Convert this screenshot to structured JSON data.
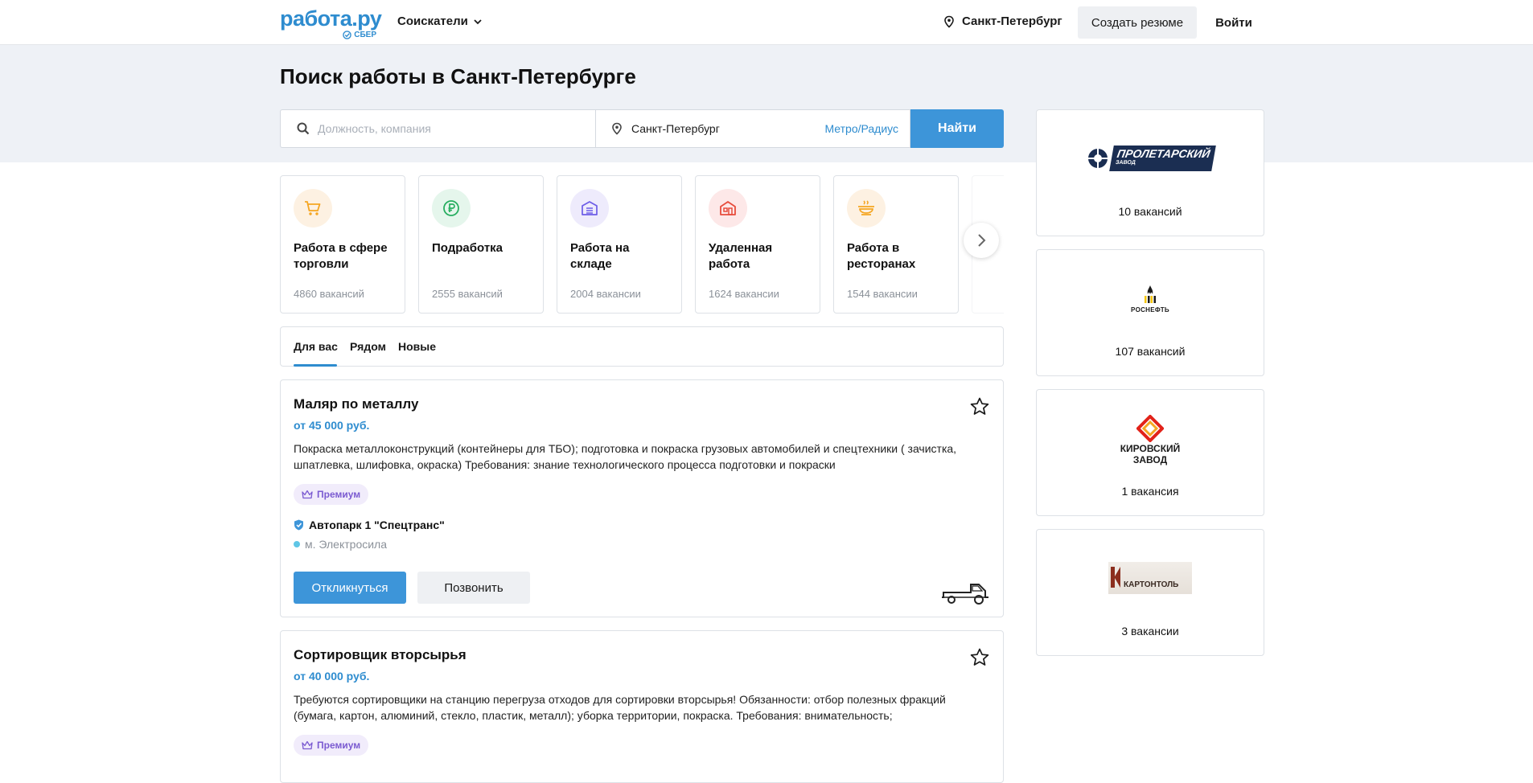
{
  "header": {
    "logo_text": "работа.ру",
    "logo_sub": "СБЕР",
    "seekers_label": "Соискатели",
    "city": "Санкт-Петербург",
    "create_resume": "Создать резюме",
    "login": "Войти"
  },
  "page_title": "Поиск работы в Санкт-Петербурге",
  "search": {
    "query_placeholder": "Должность, компания",
    "city_value": "Санкт-Петербург",
    "metro_link": "Метро/Радиус",
    "submit": "Найти"
  },
  "categories": [
    {
      "name": "Работа в сфере торговли",
      "count": "4860 вакансий",
      "icon": "cart-icon",
      "color": "#f5a623",
      "bg": "#fdf1e2"
    },
    {
      "name": "Подработка",
      "count": "2555 вакансий",
      "icon": "ruble-icon",
      "color": "#27ae60",
      "bg": "#e5f6ec"
    },
    {
      "name": "Работа на складе",
      "count": "2004 вакансии",
      "icon": "warehouse-icon",
      "color": "#6c5ce7",
      "bg": "#eeebfc"
    },
    {
      "name": "Удаленная работа",
      "count": "1624 вакансии",
      "icon": "house-icon",
      "color": "#e74c3c",
      "bg": "#fde8e8"
    },
    {
      "name": "Работа в ресторанах",
      "count": "1544 вакансии",
      "icon": "dish-icon",
      "color": "#f5a623",
      "bg": "#fdf1e2"
    }
  ],
  "tabs": [
    "Для вас",
    "Рядом",
    "Новые"
  ],
  "vacancies": [
    {
      "title": "Маляр по металлу",
      "salary": "от 45 000 руб.",
      "description": "Покраска металлоконструкций (контейнеры для ТБО); подготовка и покраска грузовых автомобилей и спецтехники ( зачистка, шпатлевка, шлифовка, окраска) Требования: знание технологического процесса подготовки и покраски",
      "badge": "Премиум",
      "company": "Автопарк 1 \"Спецтранс\"",
      "metro": "м. Электросила",
      "apply": "Откликнуться",
      "call": "Позвонить"
    },
    {
      "title": "Сортировщик вторсырья",
      "salary": "от 40 000 руб.",
      "description": "Требуются сортировщики на станцию перегруза отходов для сортировки вторсырья! Обязанности: отбор полезных фракций (бумага, картон, алюминий, стекло, пластик, металл); уборка территории, покраска. Требования: внимательность;",
      "badge": "Премиум"
    }
  ],
  "employers": [
    {
      "logo": "ПРОЛЕТАРСКИЙ",
      "logo_sub": "ЗАВОД",
      "count": "10 вакансий"
    },
    {
      "logo": "РОСНЕФТЬ",
      "count": "107 вакансий"
    },
    {
      "logo": "КИРОВСКИЙ",
      "logo_sub": "ЗАВОД",
      "count": "1 вакансия"
    },
    {
      "logo": "КАРТОНТОЛЬ",
      "count": "3 вакансии"
    }
  ],
  "colors": {
    "accent": "#2e8ccf",
    "button": "#3d95d9",
    "band": "#eef1f6",
    "premium": "#7b5bd1"
  }
}
